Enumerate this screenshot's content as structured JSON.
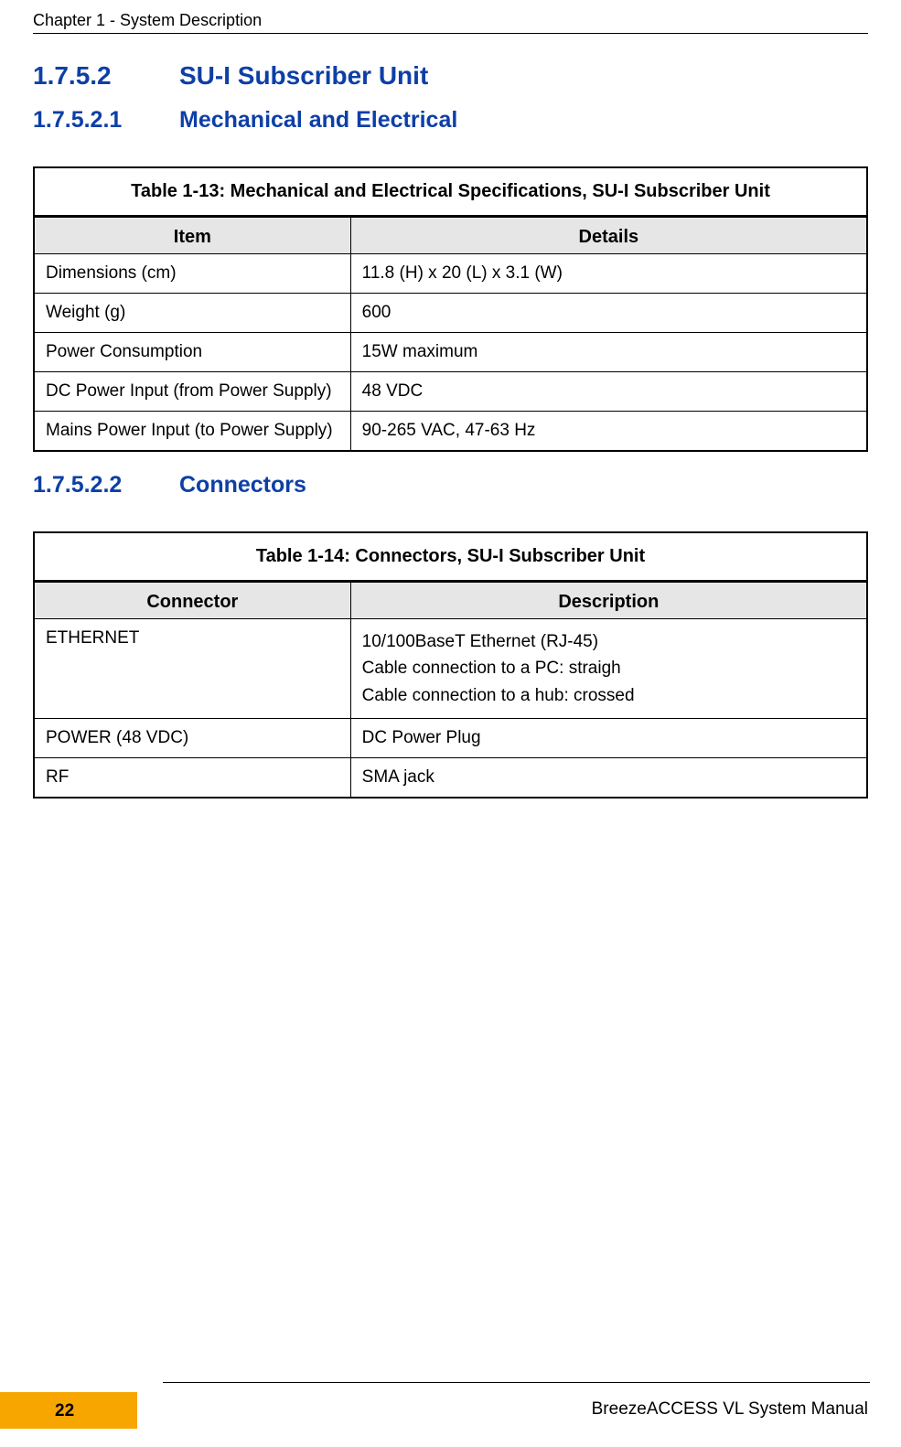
{
  "header": "Chapter 1 - System Description",
  "section_1752": {
    "num": "1.7.5.2",
    "title": "SU-I Subscriber Unit"
  },
  "section_17521": {
    "num": "1.7.5.2.1",
    "title": "Mechanical and Electrical"
  },
  "table13": {
    "caption": "Table 1-13: Mechanical and Electrical Specifications, SU-I Subscriber Unit",
    "col1": "Item",
    "col2": "Details",
    "rows": [
      {
        "item": "Dimensions (cm)",
        "details": "11.8 (H) x 20 (L) x 3.1 (W)"
      },
      {
        "item": "Weight (g)",
        "details": "600"
      },
      {
        "item": "Power Consumption",
        "details": "15W maximum"
      },
      {
        "item": "DC Power Input (from Power Supply)",
        "details": "48 VDC"
      },
      {
        "item": "Mains Power Input (to Power Supply)",
        "details": "90-265 VAC, 47-63 Hz"
      }
    ]
  },
  "section_17522": {
    "num": "1.7.5.2.2",
    "title": "Connectors"
  },
  "table14": {
    "caption": "Table 1-14: Connectors, SU-I Subscriber Unit",
    "col1": "Connector",
    "col2": "Description",
    "row0_c1": "ETHERNET",
    "row0_l1": "10/100BaseT Ethernet (RJ-45)",
    "row0_l2": "Cable connection to a PC: straigh",
    "row0_l3": "Cable connection to a hub: crossed",
    "row1_c1": "POWER (48 VDC)",
    "row1_c2": "DC Power Plug",
    "row2_c1": "RF",
    "row2_c2": "SMA jack"
  },
  "footer": {
    "page": "22",
    "title": "BreezeACCESS VL System Manual"
  }
}
